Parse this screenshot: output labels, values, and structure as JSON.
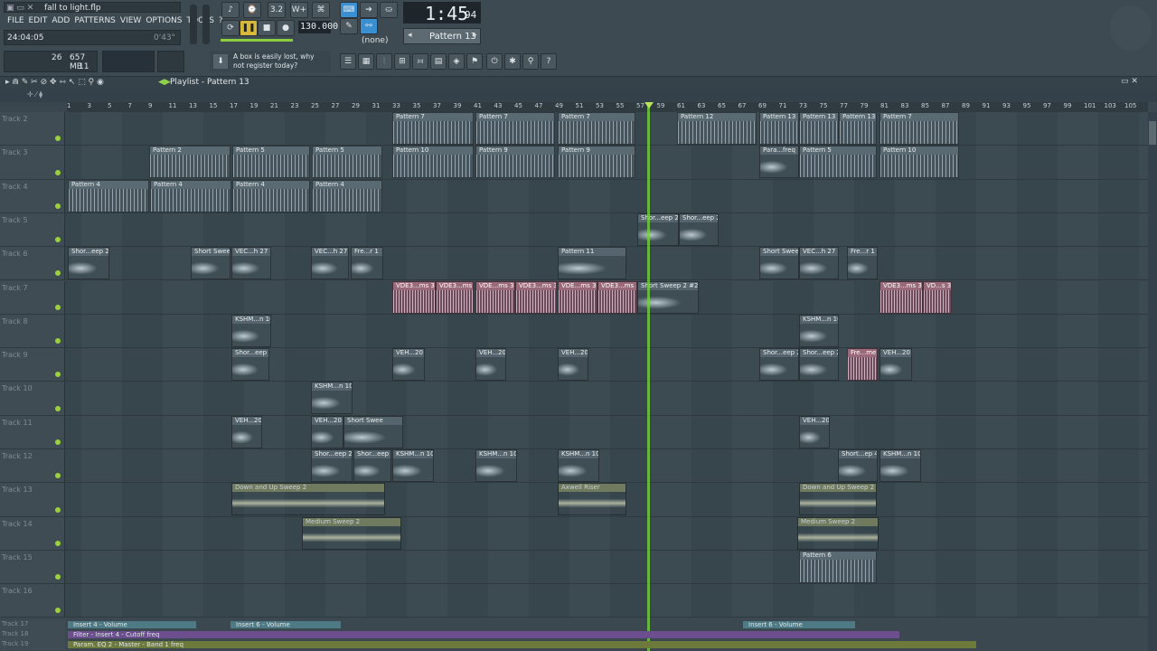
{
  "titlebar": {
    "filename": "fall to light.flp"
  },
  "menu": [
    "FILE",
    "EDIT",
    "ADD",
    "PATTERNS",
    "VIEW",
    "OPTIONS",
    "TOOLS",
    "?"
  ],
  "status": {
    "time_pos": "24:04:05",
    "sub": "0'43\"",
    "cpu": "26",
    "mem": "657 MB",
    "poly": "11"
  },
  "transport": {
    "tempo": "130.000",
    "time": "1:45",
    "time_sub": "94",
    "pattern": "Pattern 13",
    "channel": "(none)"
  },
  "hint": "A box is easily lost, why not register today?",
  "playlist": {
    "title": "Playlist - Pattern 13",
    "arrangement": "Pattern 13"
  },
  "ruler": [
    "1",
    "3",
    "5",
    "7",
    "9",
    "11",
    "13",
    "15",
    "17",
    "19",
    "21",
    "23",
    "25",
    "27",
    "29",
    "31",
    "33",
    "35",
    "37",
    "39",
    "41",
    "43",
    "45",
    "47",
    "49",
    "51",
    "53",
    "55",
    "57",
    "59",
    "61",
    "63",
    "65",
    "67",
    "69",
    "71",
    "73",
    "75",
    "77",
    "79",
    "81",
    "83",
    "85",
    "87",
    "89",
    "91",
    "93",
    "95",
    "97",
    "99",
    "101",
    "103",
    "105"
  ],
  "tracks": [
    "Track 2",
    "Track 3",
    "Track 4",
    "Track 5",
    "Track 6",
    "Track 7",
    "Track 8",
    "Track 9",
    "Track 10",
    "Track 11",
    "Track 12",
    "Track 13",
    "Track 14",
    "Track 15",
    "Track 16"
  ],
  "auto_tracks": [
    {
      "label": "Track 17",
      "clips": [
        "Insert 4 - Volume",
        "Insert 6 - Volume",
        "Insert 6 - Volume"
      ]
    },
    {
      "label": "Track 18",
      "clips": [
        "Filter - Insert 4 - Cutoff freq"
      ]
    },
    {
      "label": "Track 19",
      "clips": [
        "Param. EQ 2 - Master - Band 1 freq"
      ]
    }
  ],
  "clip_labels": {
    "r0": [
      "Pattern 7",
      "Pattern 7",
      "Pattern 7",
      "Pattern 12",
      "Pattern 13",
      "Pattern 13",
      "Pattern 13",
      "Pattern 7"
    ],
    "r1": [
      "Pattern 2",
      "Pattern 5",
      "Pattern 5",
      "Pattern 10",
      "Pattern 9",
      "Pattern 9",
      "Para...freq",
      "Pattern 5",
      "Pattern 10"
    ],
    "r2": [
      "Pattern 4",
      "Pattern 4",
      "Pattern 4",
      "Pattern 4"
    ],
    "r3": [
      "Shor...eep 2",
      "Shor...eep 2"
    ],
    "r4": [
      "Shor...eep 2",
      "Short Swee",
      "VEC...h 27",
      "VEC...h 27",
      "Fre...r 1",
      "Pattern 11",
      "Short Swee",
      "VEC...h 27",
      "Fre...r 1"
    ],
    "r5": [
      "VDE3...ms 3",
      "VDE3...ms 3",
      "VDE...ms 3",
      "VDE3...ms 3",
      "VDE...ms 3",
      "VDE3...ms 3",
      "Short Sweep 2 #2",
      "VDE3...ms 3",
      "VD...s 3"
    ],
    "r6": [
      "KSHM...n 10",
      "KSHM...n 10"
    ],
    "r7": [
      "Shor...eep 2",
      "VEH...20",
      "VEH...20",
      "VEH...20",
      "Shor...eep 2",
      "Shor...eep 2",
      "Fre...me",
      "VEH...20"
    ],
    "r8": [
      "KSHM...n 10"
    ],
    "r9": [
      "VEH...20",
      "VEH...20",
      "Short Swee",
      "VEH...20"
    ],
    "r10": [
      "Shor...eep 2",
      "Shor...eep 2",
      "KSHM...n 10",
      "KSHM...n 10",
      "KSHM...n 10",
      "Short...ep 4",
      "KSHM...n 10"
    ],
    "r11": [
      "Down and Up Sweep 2",
      "Axwell Riser",
      "Down and Up Sweep 2"
    ],
    "r12": [
      "Medium Sweep 2",
      "Medium Sweep 2"
    ],
    "r13": [
      "Pattern 6"
    ]
  }
}
